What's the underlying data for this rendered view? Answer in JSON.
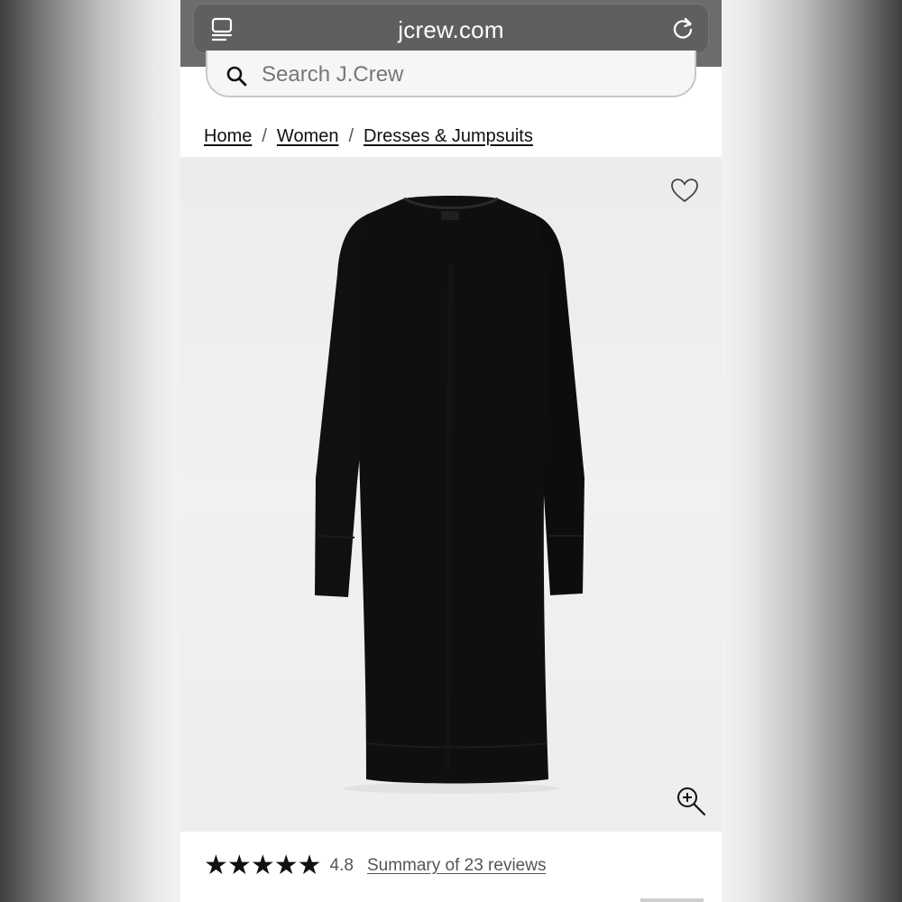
{
  "browser": {
    "url": "jcrew.com",
    "tabs_icon": "tabs-icon",
    "reload_icon": "reload-icon"
  },
  "search": {
    "placeholder": "Search J.Crew",
    "icon": "search-icon"
  },
  "breadcrumb": {
    "items": [
      "Home",
      "Women",
      "Dresses & Jumpsuits"
    ],
    "separator": "/"
  },
  "product": {
    "wishlist_icon": "heart-icon",
    "zoom_icon": "zoom-in-icon",
    "rating": {
      "stars_filled": 5,
      "star_glyph": "★",
      "value": "4.8",
      "reviews_label": "Summary of 23 reviews"
    }
  },
  "colors": {
    "browser_chrome": "#6c6c6c",
    "text": "#111111",
    "image_bg": "#eeeeee",
    "dress": "#0e0e0e"
  }
}
